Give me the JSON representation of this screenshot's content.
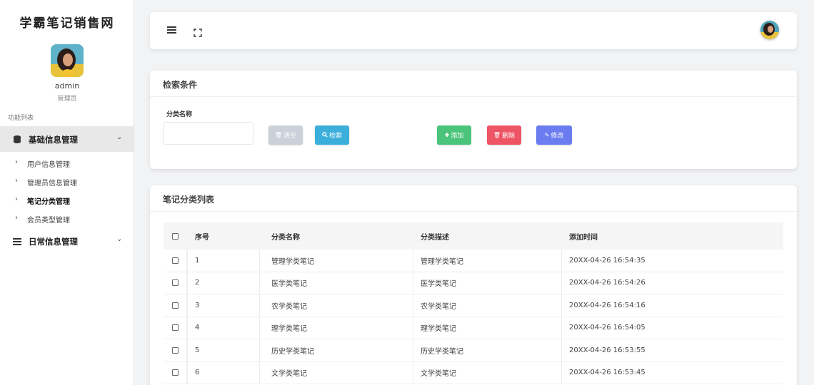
{
  "sidebar": {
    "brand": "学霸笔记销售网",
    "admin_name": "admin",
    "admin_role": "管理员",
    "menu_caption": "功能列表",
    "groups": [
      {
        "label": "基础信息管理",
        "icon": "database-icon",
        "items": [
          {
            "label": "用户信息管理"
          },
          {
            "label": "管理员信息管理"
          },
          {
            "label": "笔记分类管理"
          },
          {
            "label": "会员类型管理"
          }
        ]
      },
      {
        "label": "日常信息管理",
        "icon": "list-icon",
        "items": []
      }
    ]
  },
  "topbar": {
    "menu_icon": "hamburger-menu-icon",
    "fullscreen_icon": "fullscreen-icon"
  },
  "search_card": {
    "title": "检索条件",
    "field_label": "分类名称",
    "field_value": "",
    "buttons": {
      "clear": "清空",
      "search": "检索",
      "add": "添加",
      "delete": "删除",
      "edit": "修改"
    }
  },
  "list_card": {
    "title": "笔记分类列表",
    "columns": [
      "序号",
      "分类名称",
      "分类描述",
      "添加时间"
    ],
    "rows": [
      {
        "no": "1",
        "name": "管理学类笔记",
        "desc": "管理学类笔记",
        "time": "20XX-04-26 16:54:35"
      },
      {
        "no": "2",
        "name": "医学类笔记",
        "desc": "医学类笔记",
        "time": "20XX-04-26 16:54:26"
      },
      {
        "no": "3",
        "name": "农学类笔记",
        "desc": "农学类笔记",
        "time": "20XX-04-26 16:54:16"
      },
      {
        "no": "4",
        "name": "理学类笔记",
        "desc": "理学类笔记",
        "time": "20XX-04-26 16:54:05"
      },
      {
        "no": "5",
        "name": "历史学类笔记",
        "desc": "历史学类笔记",
        "time": "20XX-04-26 16:53:55"
      },
      {
        "no": "6",
        "name": "文学类笔记",
        "desc": "文学类笔记",
        "time": "20XX-04-26 16:53:45"
      }
    ]
  },
  "colors": {
    "clear": "#ccd1d9",
    "search": "#3bafda",
    "add": "#4ac47a",
    "delete": "#ed5565",
    "edit": "#6a7cf0"
  }
}
